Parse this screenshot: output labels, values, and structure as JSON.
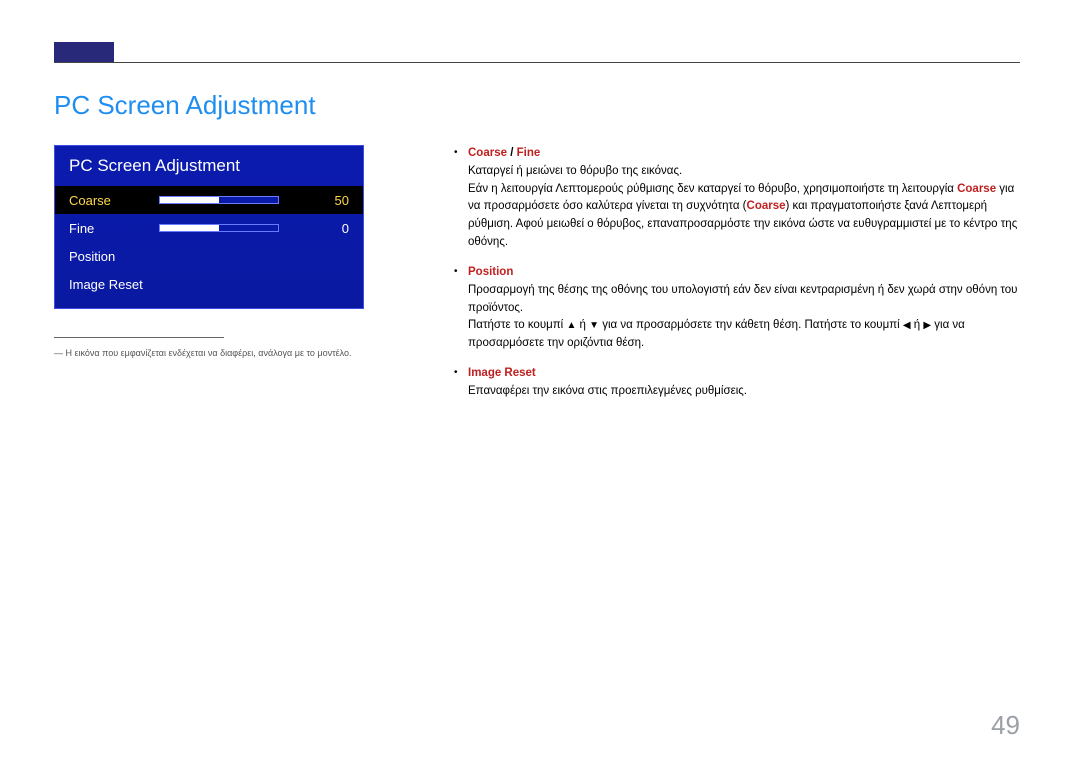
{
  "heading": "PC Screen Adjustment",
  "osd": {
    "title": "PC Screen Adjustment",
    "rows": [
      {
        "label": "Coarse",
        "value": "50",
        "fillPercent": 50,
        "selected": true,
        "hasSlider": true
      },
      {
        "label": "Fine",
        "value": "0",
        "fillPercent": 50,
        "selected": false,
        "hasSlider": true
      },
      {
        "label": "Position",
        "value": "",
        "selected": false,
        "hasSlider": false
      },
      {
        "label": "Image Reset",
        "value": "",
        "selected": false,
        "hasSlider": false
      }
    ]
  },
  "footnote_prefix": "―",
  "footnote": "Η εικόνα που εμφανίζεται ενδέχεται να διαφέρει, ανάλογα με το μοντέλο.",
  "right": {
    "item1": {
      "term_a": "Coarse",
      "sep": " / ",
      "term_b": "Fine",
      "p1": "Καταργεί ή μειώνει το θόρυβο της εικόνας.",
      "p2a": "Εάν η λειτουργία Λεπτομερούς ρύθμισης δεν καταργεί το θόρυβο, χρησιμοποιήστε τη λειτουργία ",
      "coarse1": "Coarse",
      "p2b": " για να προσαρμόσετε όσο καλύτερα γίνεται τη συχνότητα (",
      "coarse2": "Coarse",
      "p2c": ") και πραγματοποιήστε ξανά Λεπτομερή ρύθμιση. Αφού μειωθεί ο θόρυβος, επαναπροσαρμόστε την εικόνα ώστε να ευθυγραμμιστεί με το κέντρο της οθόνης."
    },
    "item2": {
      "term": "Position",
      "p1": "Προσαρμογή της θέσης της οθόνης του υπολογιστή εάν δεν είναι κεντραρισμένη ή δεν χωρά στην οθόνη του προϊόντος.",
      "p2a": "Πατήστε το κουμπί ",
      "p2b": " ή ",
      "p2c": " για να προσαρμόσετε την κάθετη θέση. Πατήστε το κουμπί ",
      "p2d": " ή ",
      "p2e": " για να προσαρμόσετε την οριζόντια θέση.",
      "arrows": {
        "up": "▲",
        "down": "▼",
        "left": "◀",
        "right": "▶"
      }
    },
    "item3": {
      "term": "Image Reset",
      "p1": "Επαναφέρει την εικόνα στις προεπιλεγμένες ρυθμίσεις."
    }
  },
  "page_number": "49"
}
